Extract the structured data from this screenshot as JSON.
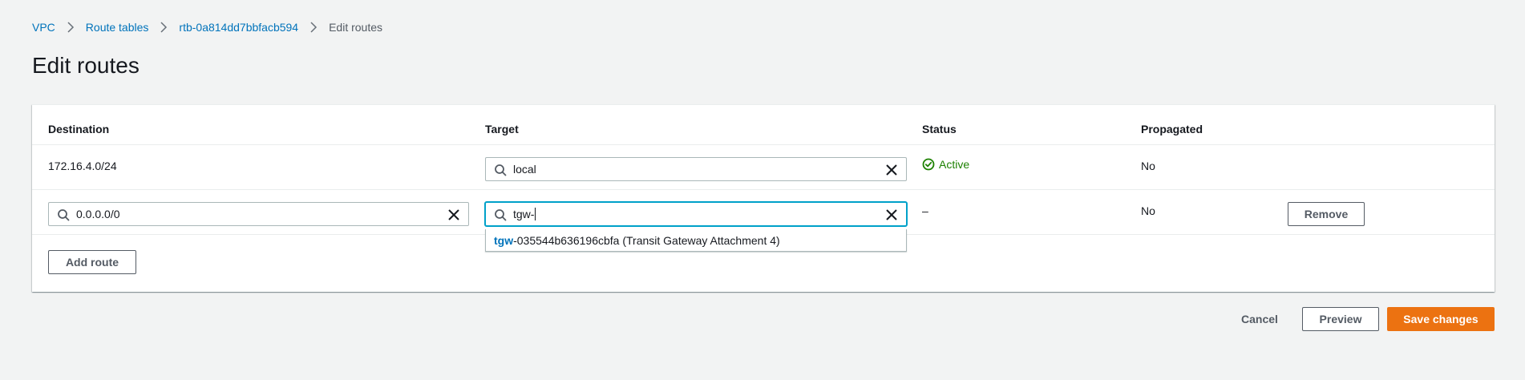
{
  "breadcrumb": {
    "items": [
      "VPC",
      "Route tables",
      "rtb-0a814dd7bbfacb594"
    ],
    "current": "Edit routes"
  },
  "page": {
    "title": "Edit routes"
  },
  "table": {
    "headers": {
      "destination": "Destination",
      "target": "Target",
      "status": "Status",
      "propagated": "Propagated"
    },
    "rows": [
      {
        "destination": "172.16.4.0/24",
        "target": "local",
        "status": "Active",
        "propagated": "No"
      },
      {
        "destination": "0.0.0.0/0",
        "target": "tgw-",
        "status": "–",
        "propagated": "No",
        "remove_label": "Remove"
      }
    ],
    "add_route_label": "Add route"
  },
  "dropdown": {
    "match": "tgw",
    "rest": "-035544b636196cbfa (Transit Gateway Attachment 4)"
  },
  "footer": {
    "cancel_label": "Cancel",
    "preview_label": "Preview",
    "save_label": "Save changes"
  },
  "colors": {
    "link": "#0073bb",
    "primary": "#ec7211",
    "success": "#1d8102",
    "focus": "#00a1c9"
  },
  "icons": {
    "search": "search-icon",
    "clear": "close-icon",
    "status": "status-positive-icon",
    "separator": "chevron-right-icon"
  }
}
